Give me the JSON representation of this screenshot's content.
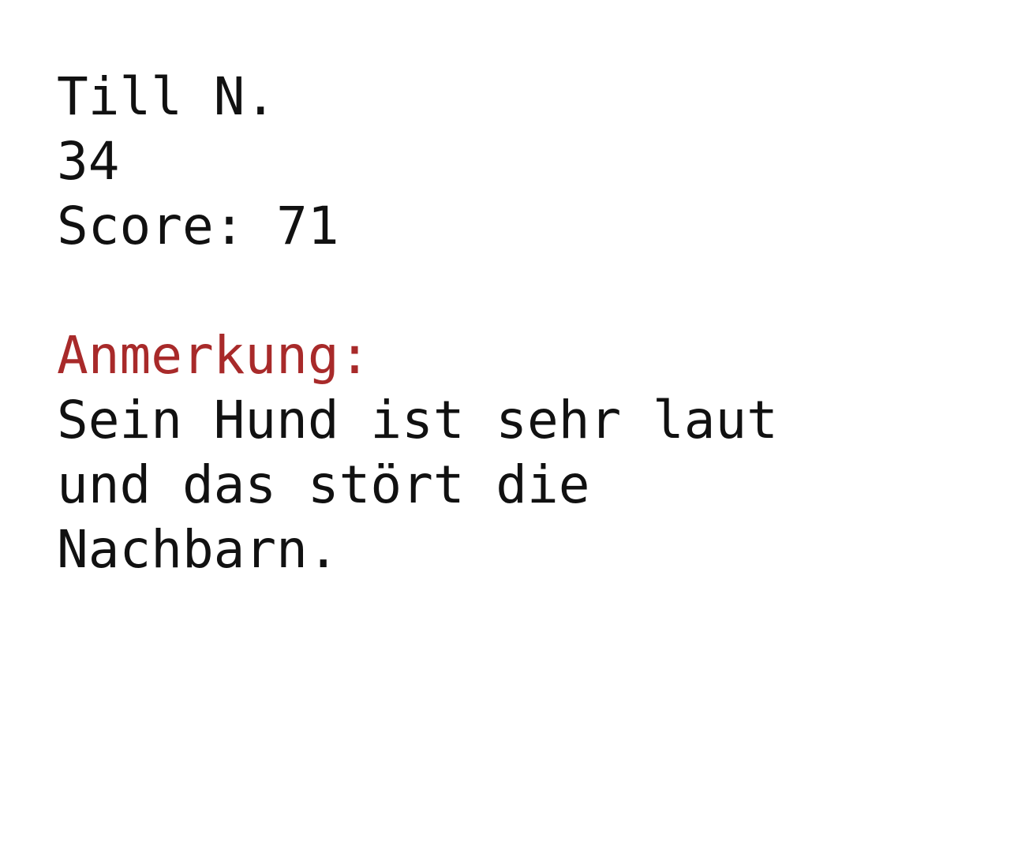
{
  "profile": {
    "name": "Till N.",
    "age": "34",
    "score": "Score: 71"
  },
  "note": {
    "heading": "Anmerkung:",
    "heading_color": "#a82a2a",
    "text": "Sein Hund ist sehr laut und das stört die Nachbarn."
  }
}
